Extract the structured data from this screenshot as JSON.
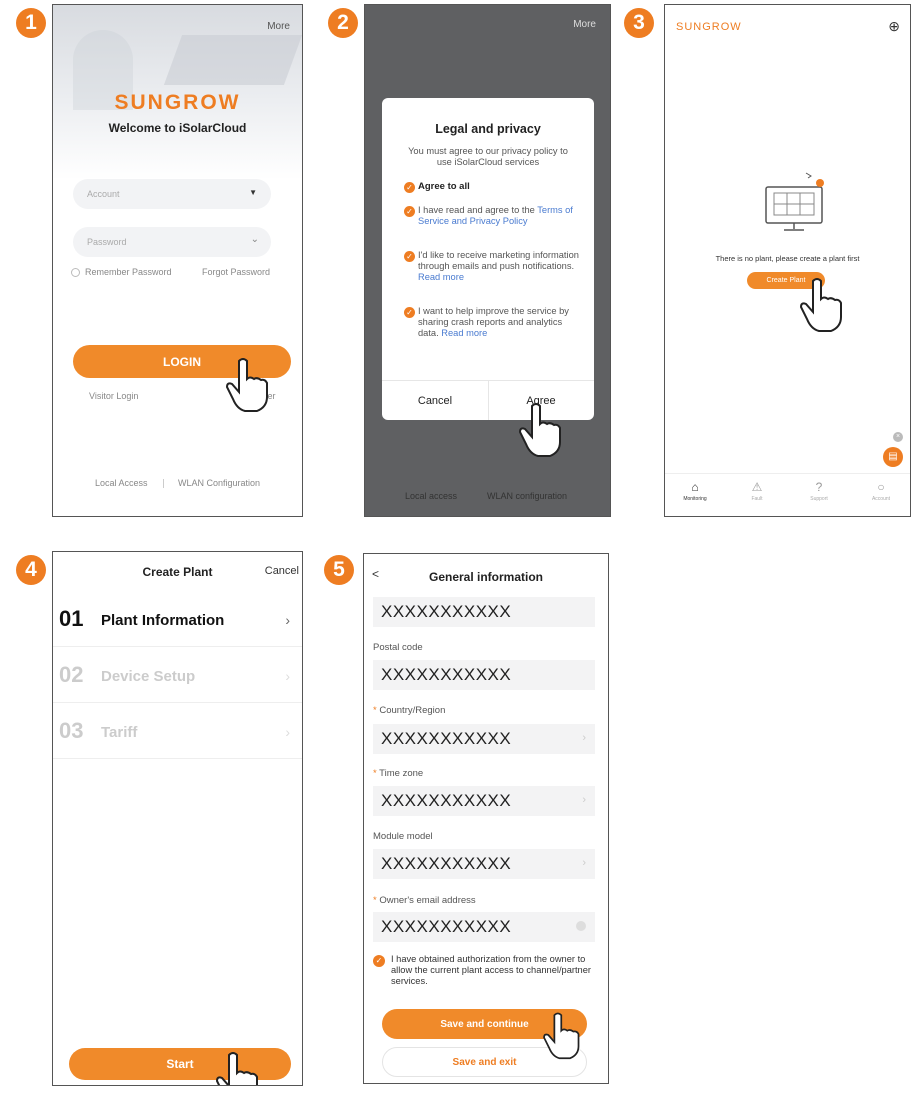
{
  "steps": [
    "1",
    "2",
    "3",
    "4",
    "5"
  ],
  "screen1": {
    "more": "More",
    "brand": "SUNGROW",
    "welcome": "Welcome to iSolarCloud",
    "account_placeholder": "Account",
    "password_placeholder": "Password",
    "remember": "Remember Password",
    "forgot": "Forgot Password",
    "login": "LOGIN",
    "visitor": "Visitor Login",
    "register": "ter",
    "local_access": "Local Access",
    "wlan": "WLAN Configuration"
  },
  "screen2": {
    "more": "More",
    "title": "Legal and privacy",
    "intro": "You must agree to our privacy policy to use iSolarCloud services",
    "agree_all": "Agree to all",
    "opt1_text": "I have read and agree to the",
    "opt1_link": "Terms of Service and Privacy Policy",
    "opt2_text": "I'd like to receive marketing information through emails and push notifications.",
    "opt2_link": "Read more",
    "opt3_text": "I want to help improve the service by sharing crash reports and analytics data.",
    "opt3_link": "Read more",
    "cancel": "Cancel",
    "agree": "Agree",
    "local_access": "Local access",
    "wlan": "WLAN configuration"
  },
  "screen3": {
    "brand": "SUNGROW",
    "empty_text": "There is no plant, please create a plant first",
    "create": "Create Plant",
    "nav": [
      "Monitoring",
      "Fault",
      "Support",
      "Account"
    ]
  },
  "screen4": {
    "title": "Create Plant",
    "cancel": "Cancel",
    "steps": [
      {
        "num": "01",
        "label": "Plant Information"
      },
      {
        "num": "02",
        "label": "Device Setup"
      },
      {
        "num": "03",
        "label": "Tariff"
      }
    ],
    "start": "Start"
  },
  "screen5": {
    "back": "<",
    "title": "General information",
    "top_value": "XXXXXXXXXXX",
    "fields": [
      {
        "label": "Postal code",
        "required": "",
        "value": "XXXXXXXXXXX"
      },
      {
        "label": "Country/Region",
        "required": "*",
        "value": "XXXXXXXXXXX"
      },
      {
        "label": "Time zone",
        "required": "*",
        "value": "XXXXXXXXXXX"
      },
      {
        "label": "Module model",
        "required": "",
        "value": "XXXXXXXXXXX"
      },
      {
        "label": "Owner's email address",
        "required": "*",
        "value": "XXXXXXXXXXX"
      }
    ],
    "authorization": "I have obtained authorization from the owner to allow the current plant access to channel/partner services.",
    "save_continue": "Save and continue",
    "save_exit": "Save and exit"
  },
  "colors": {
    "accent": "#ee7d22",
    "overlay": "#5f6062",
    "link": "#4a7bd0"
  }
}
